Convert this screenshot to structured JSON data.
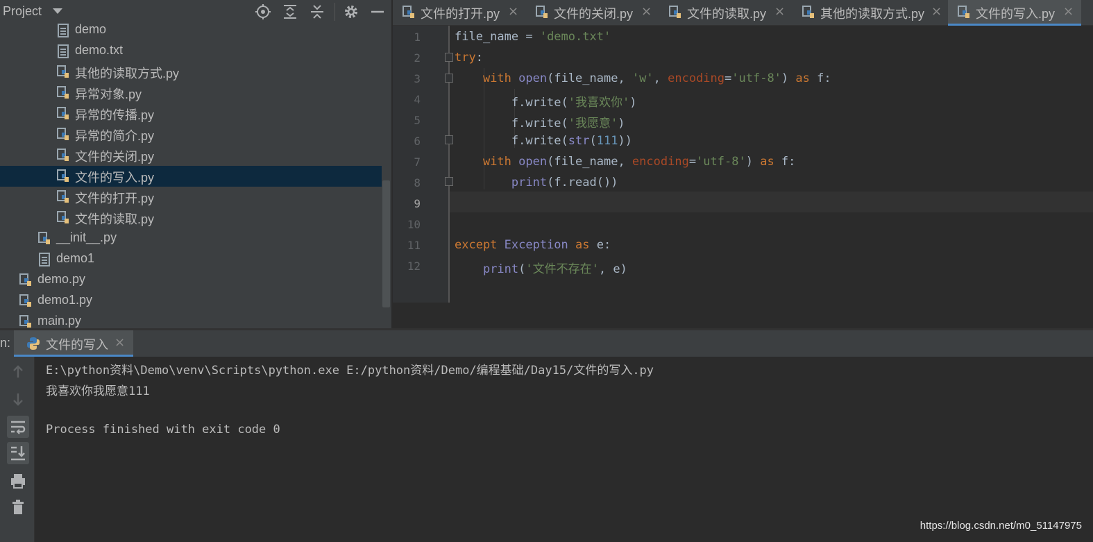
{
  "project_panel": {
    "title": "Project",
    "tree": [
      {
        "label": "demo",
        "type": "file"
      },
      {
        "label": "demo.txt",
        "type": "file"
      },
      {
        "label": "其他的读取方式.py",
        "type": "python"
      },
      {
        "label": "异常对象.py",
        "type": "python"
      },
      {
        "label": "异常的传播.py",
        "type": "python"
      },
      {
        "label": "异常的简介.py",
        "type": "python"
      },
      {
        "label": "文件的关闭.py",
        "type": "python"
      },
      {
        "label": "文件的写入.py",
        "type": "python",
        "selected": true
      },
      {
        "label": "文件的打开.py",
        "type": "python"
      },
      {
        "label": "文件的读取.py",
        "type": "python"
      },
      {
        "label": "__init__.py",
        "type": "python"
      },
      {
        "label": "demo1",
        "type": "file"
      },
      {
        "label": "demo.py",
        "type": "python"
      },
      {
        "label": "demo1.py",
        "type": "python"
      },
      {
        "label": "main.py",
        "type": "python"
      }
    ],
    "header_icons": [
      "locate-icon",
      "expand-all-icon",
      "collapse-all-icon",
      "gear-icon",
      "minimize-icon"
    ]
  },
  "editor": {
    "tabs": [
      {
        "label": "文件的打开.py",
        "active": false
      },
      {
        "label": "文件的关闭.py",
        "active": false
      },
      {
        "label": "文件的读取.py",
        "active": false
      },
      {
        "label": "其他的读取方式.py",
        "active": false
      },
      {
        "label": "文件的写入.py",
        "active": true
      }
    ],
    "close_glyph": "×",
    "line_numbers": [
      "1",
      "2",
      "3",
      "4",
      "5",
      "6",
      "7",
      "8",
      "9",
      "10",
      "11",
      "12"
    ],
    "current_line": "9",
    "code": [
      [
        {
          "t": "file_name = ",
          "c": "plain"
        },
        {
          "t": "'demo.txt'",
          "c": "str"
        }
      ],
      [
        {
          "t": "try",
          "c": "kw"
        },
        {
          "t": ":",
          "c": "plain"
        }
      ],
      [
        {
          "t": "    ",
          "c": "plain"
        },
        {
          "t": "with ",
          "c": "kw"
        },
        {
          "t": "open",
          "c": "bi"
        },
        {
          "t": "(file_name, ",
          "c": "plain"
        },
        {
          "t": "'w'",
          "c": "str"
        },
        {
          "t": ", ",
          "c": "plain"
        },
        {
          "t": "encoding",
          "c": "param"
        },
        {
          "t": "=",
          "c": "plain"
        },
        {
          "t": "'utf-8'",
          "c": "str"
        },
        {
          "t": ") ",
          "c": "plain"
        },
        {
          "t": "as ",
          "c": "kw"
        },
        {
          "t": "f:",
          "c": "plain"
        }
      ],
      [
        {
          "t": "        f.write(",
          "c": "plain"
        },
        {
          "t": "'我喜欢你'",
          "c": "str"
        },
        {
          "t": ")",
          "c": "plain"
        }
      ],
      [
        {
          "t": "        f.write(",
          "c": "plain"
        },
        {
          "t": "'我愿意'",
          "c": "str"
        },
        {
          "t": ")",
          "c": "plain"
        }
      ],
      [
        {
          "t": "        f.write(",
          "c": "plain"
        },
        {
          "t": "str",
          "c": "bi"
        },
        {
          "t": "(",
          "c": "plain"
        },
        {
          "t": "111",
          "c": "num"
        },
        {
          "t": "))",
          "c": "plain"
        }
      ],
      [
        {
          "t": "    ",
          "c": "plain"
        },
        {
          "t": "with ",
          "c": "kw"
        },
        {
          "t": "open",
          "c": "bi"
        },
        {
          "t": "(file_name, ",
          "c": "plain"
        },
        {
          "t": "encoding",
          "c": "param"
        },
        {
          "t": "=",
          "c": "plain"
        },
        {
          "t": "'utf-8'",
          "c": "str"
        },
        {
          "t": ") ",
          "c": "plain"
        },
        {
          "t": "as ",
          "c": "kw"
        },
        {
          "t": "f:",
          "c": "plain"
        }
      ],
      [
        {
          "t": "        ",
          "c": "plain"
        },
        {
          "t": "print",
          "c": "bi"
        },
        {
          "t": "(f.read())",
          "c": "plain"
        }
      ],
      [],
      [],
      [
        {
          "t": "except ",
          "c": "kw"
        },
        {
          "t": "Exception ",
          "c": "bi"
        },
        {
          "t": "as ",
          "c": "kw"
        },
        {
          "t": "e:",
          "c": "plain"
        }
      ],
      [
        {
          "t": "    ",
          "c": "plain"
        },
        {
          "t": "print",
          "c": "bi"
        },
        {
          "t": "(",
          "c": "plain"
        },
        {
          "t": "'文件不存在'",
          "c": "str"
        },
        {
          "t": ", e)",
          "c": "plain"
        }
      ]
    ]
  },
  "run_panel": {
    "prefix": "n:",
    "tab_label": "文件的写入",
    "close_glyph": "×",
    "toolbar_icons": [
      "up-arrow-icon",
      "down-arrow-icon",
      "soft-wrap-icon",
      "scroll-to-end-icon",
      "print-icon",
      "trash-icon"
    ],
    "output": [
      "E:\\python资料\\Demo\\venv\\Scripts\\python.exe E:/python资料/Demo/编程基础/Day15/文件的写入.py",
      "我喜欢你我愿意111",
      "",
      "Process finished with exit code 0"
    ]
  },
  "watermark": "https://blog.csdn.net/m0_51147975",
  "colors": {
    "keyword": "#cc7832",
    "string": "#6a8759",
    "number": "#6897bb",
    "builtin": "#8888c6",
    "param": "#aa4926",
    "selection": "#0d293e",
    "accent": "#4a88c7"
  }
}
